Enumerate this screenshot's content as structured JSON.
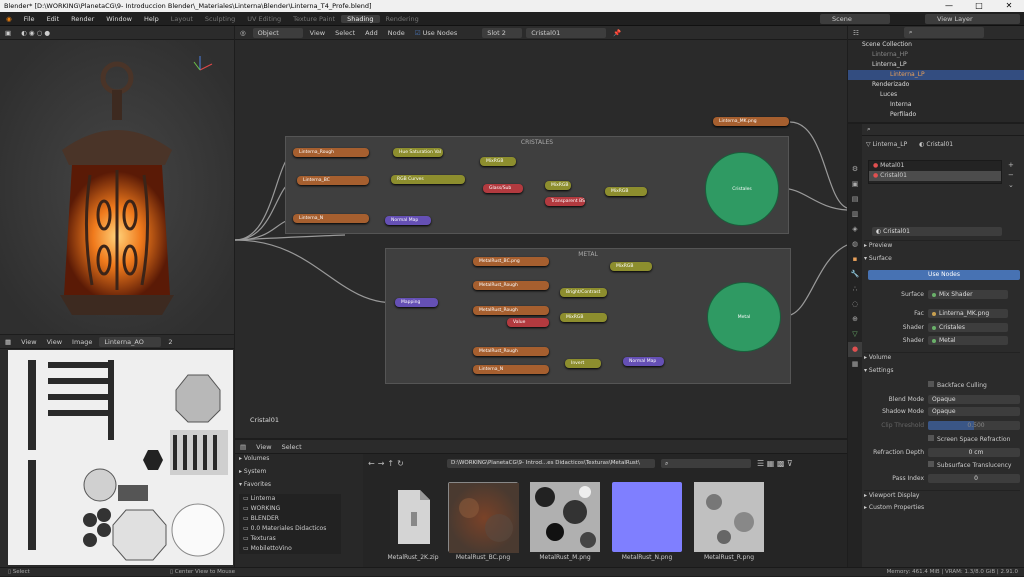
{
  "window": {
    "title": "Blender* [D:\\WORKING\\PlanetaCG\\9- Introduccion Blender\\_Materiales\\Linterna\\Blender\\Linterna_T4_Profe.blend]",
    "minimize": "—",
    "maximize": "□",
    "close": "✕"
  },
  "menu": [
    "File",
    "Edit",
    "Render",
    "Window",
    "Help"
  ],
  "workspaces": [
    "Layout",
    "Sculpting",
    "UV Editing",
    "Texture Paint",
    "Shading",
    "Rendering"
  ],
  "active_workspace": "Shading",
  "scene": {
    "label": "Scene",
    "view_layer": "View Layer"
  },
  "node_header": {
    "mode": "Object",
    "view": "View",
    "select": "Select",
    "add": "Add",
    "node": "Node",
    "use_nodes": "Use Nodes",
    "slot": "Slot 2",
    "material": "Cristal01"
  },
  "frames": {
    "cristales": "CRISTALES",
    "metal": "METAL"
  },
  "nodes": {
    "top": "Linterna_MK.png",
    "c1": "Linterna_Rough",
    "c2": "Linterna_BC",
    "c3": "Linterna_N",
    "c4": "Hue Saturation Val",
    "c5": "RGB Curves",
    "c6": "MixRGB",
    "c7": "Glass/Sub",
    "c8": "MixRGB",
    "c9": "MixRGB",
    "c10": "Principled BSDF",
    "c11": "Transparent BSDF",
    "c12": "Normal Map",
    "c13": "Cristales",
    "m1": "Mapping",
    "m2": "MetalRust_BC.png",
    "m3": "MetalRust_Rough",
    "m4": "MetalRust_Rough",
    "m5": "Value",
    "m6": "MetalRust_Rough",
    "m7": "Linterna_N",
    "m8": "MixRGB",
    "m9": "Bright/Contrast",
    "m10": "MixRGB",
    "m11": "Invert",
    "m12": "Normal Map",
    "m13": "Metal"
  },
  "node_editor_material": "Cristal01",
  "image_editor": {
    "view": "View",
    "view2": "View",
    "image": "Image",
    "image_name": "Linterna_AO",
    "users": "2"
  },
  "file_browser": {
    "view": "View",
    "select": "Select",
    "sidebar_sections": [
      "Volumes",
      "System",
      "Favorites"
    ],
    "favorites": [
      "Linterna",
      "WORKING",
      "BLENDER",
      "0.0 Materiales Didacticos",
      "Texturas",
      "MobilettoVino"
    ],
    "path": "D:\\WORKING\\PlanetaCG\\9- Introd...es Didacticos\\Texturas\\MetalRust\\",
    "files": [
      {
        "name": "MetalRust_2K.zip",
        "color": "#cfcfcf"
      },
      {
        "name": "MetalRust_BC.png",
        "color": "#6b3a22"
      },
      {
        "name": "MetalRust_M.png",
        "color": "#9a9a9a"
      },
      {
        "name": "MetalRust_N.png",
        "color": "#7f7fff"
      },
      {
        "name": "MetalRust_R.png",
        "color": "#b5b5b5"
      }
    ]
  },
  "outliner": {
    "items": [
      "Scene Collection",
      "Linterna_HP",
      "Linterna_LP",
      "Linterna_LP",
      "Renderizado",
      "Luces",
      "Interna",
      "Perfilado"
    ]
  },
  "properties": {
    "object": "Linterna_LP",
    "material": "Cristal01",
    "slots": [
      "Metal01",
      "Cristal01"
    ],
    "mat_name": "Cristal01",
    "preview": "Preview",
    "surface": "Surface",
    "use_nodes": "Use Nodes",
    "surface_label": "Surface",
    "surface_value": "Mix Shader",
    "fac_label": "Fac",
    "fac_value": "Linterna_MK.png",
    "shader1_label": "Shader",
    "shader1_value": "Cristales",
    "shader2_label": "Shader",
    "shader2_value": "Metal",
    "volume": "Volume",
    "settings": "Settings",
    "backface": "Backface Culling",
    "blend_label": "Blend Mode",
    "blend_value": "Opaque",
    "shadow_label": "Shadow Mode",
    "shadow_value": "Opaque",
    "clip_label": "Clip Threshold",
    "clip_value": "0.500",
    "ssr": "Screen Space Refraction",
    "refr_label": "Refraction Depth",
    "refr_value": "0 cm",
    "sss": "Subsurface Translucency",
    "pass_label": "Pass Index",
    "pass_value": "0",
    "viewport_display": "Viewport Display",
    "custom_props": "Custom Properties"
  },
  "status": {
    "select": "Select",
    "center": "Center View to Mouse",
    "memory": "Memory: 461.4 MiB | VRAM: 1.3/8.0 GiB | 2.91.0"
  },
  "colors": {
    "accent": "#4772b3",
    "bsdf": "#2f9a63",
    "texture_node": "#a65f2f",
    "color_node": "#8d8e2e",
    "vector_node": "#6550b5",
    "value_node": "#b23a3f"
  }
}
